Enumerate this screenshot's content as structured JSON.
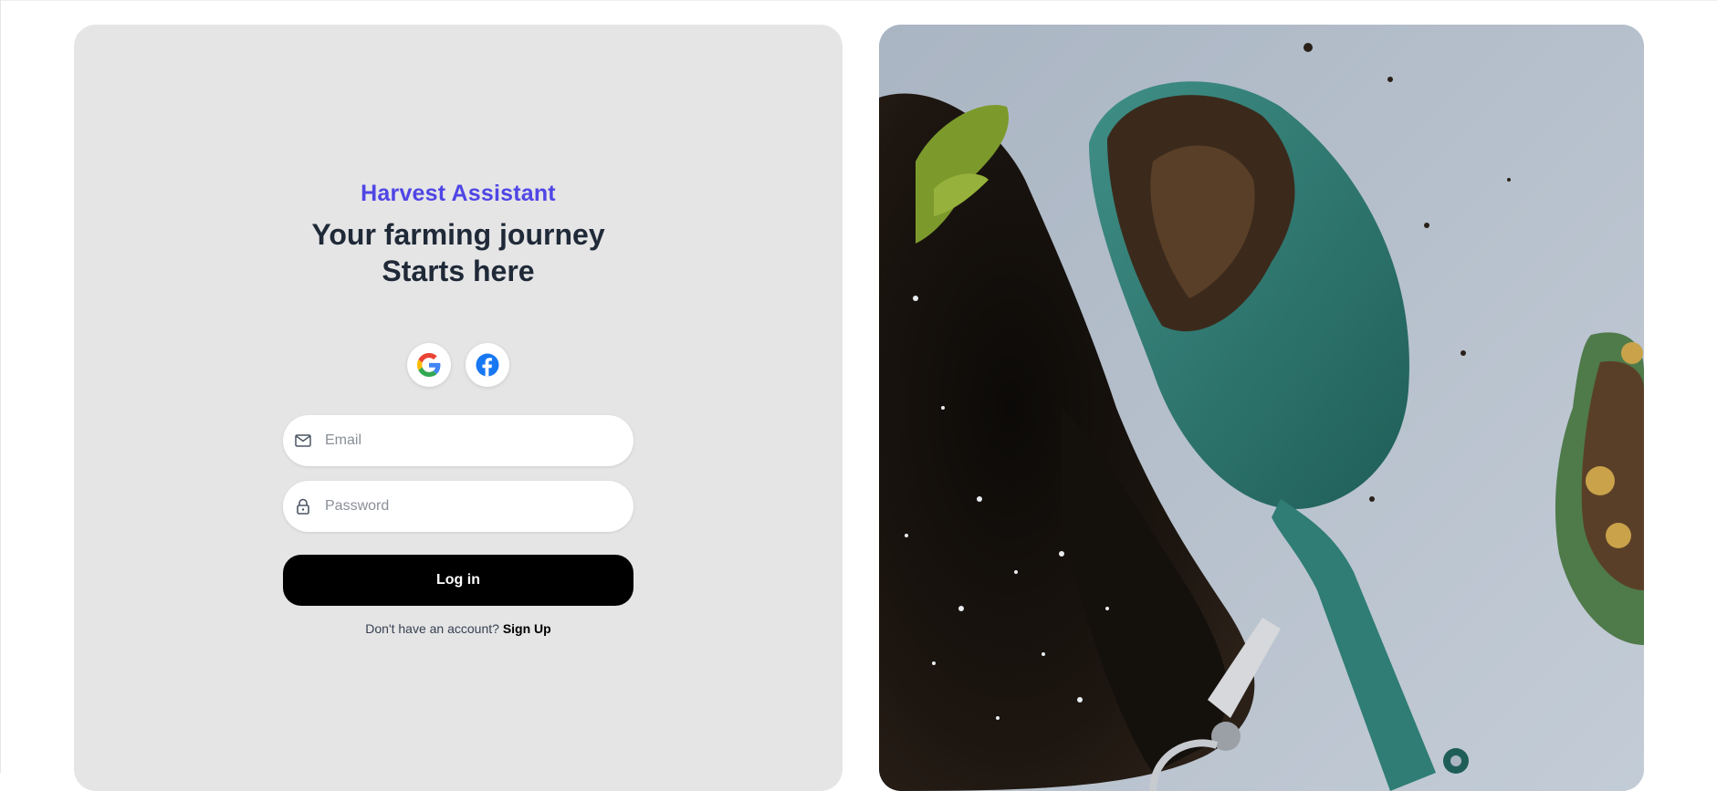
{
  "brand": {
    "name": "Harvest Assistant",
    "color": "#4f46e5"
  },
  "headline": {
    "line1": "Your farming journey",
    "line2": "Starts here"
  },
  "social": [
    {
      "provider": "Google",
      "icon": "google-icon"
    },
    {
      "provider": "Facebook",
      "icon": "facebook-icon"
    }
  ],
  "form": {
    "email": {
      "placeholder": "Email",
      "value": "",
      "icon": "mail-icon"
    },
    "password": {
      "placeholder": "Password",
      "value": "",
      "icon": "lock-icon"
    },
    "submit_label": "Log in"
  },
  "signup": {
    "prompt": "Don't have an account?",
    "link_label": "Sign Up"
  },
  "colors": {
    "panel": "#e5e5e6",
    "button": "#000000",
    "accent": "#4f46e5"
  }
}
